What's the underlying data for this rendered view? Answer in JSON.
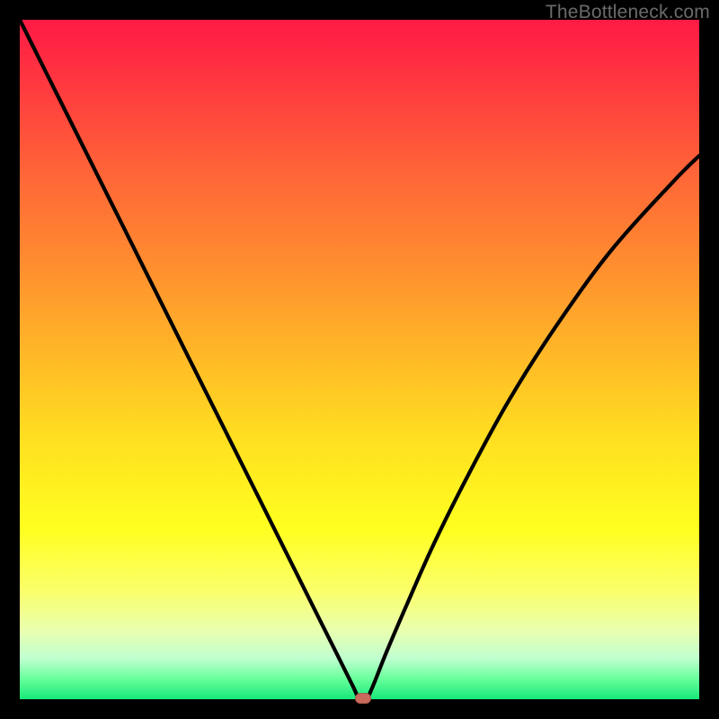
{
  "watermark": "TheBottleneck.com",
  "colors": {
    "frame": "#000000",
    "curve": "#000000",
    "marker": "#c96a5c",
    "gradient_top": "#ff1a45",
    "gradient_bottom": "#17e87a"
  },
  "chart_data": {
    "type": "line",
    "title": "",
    "xlabel": "",
    "ylabel": "",
    "xlim": [
      0,
      100
    ],
    "ylim": [
      0,
      100
    ],
    "series": [
      {
        "name": "bottleneck-curve",
        "x": [
          0,
          4,
          8,
          12,
          16,
          20,
          24,
          28,
          32,
          36,
          40,
          44,
          47,
          49,
          50,
          51,
          52,
          54,
          57,
          61,
          66,
          72,
          79,
          87,
          96,
          100
        ],
        "y": [
          100,
          92,
          84,
          76,
          68,
          60,
          52,
          44,
          36,
          28,
          20,
          12,
          6,
          2,
          0,
          0,
          2,
          7,
          14,
          23,
          33,
          44,
          55,
          66,
          76,
          80
        ]
      }
    ],
    "marker": {
      "x": 50.5,
      "y": 0
    },
    "notes": "V-shaped bottleneck curve on rainbow gradient; axes unlabeled; minimum near center with small rounded marker at the trough."
  }
}
